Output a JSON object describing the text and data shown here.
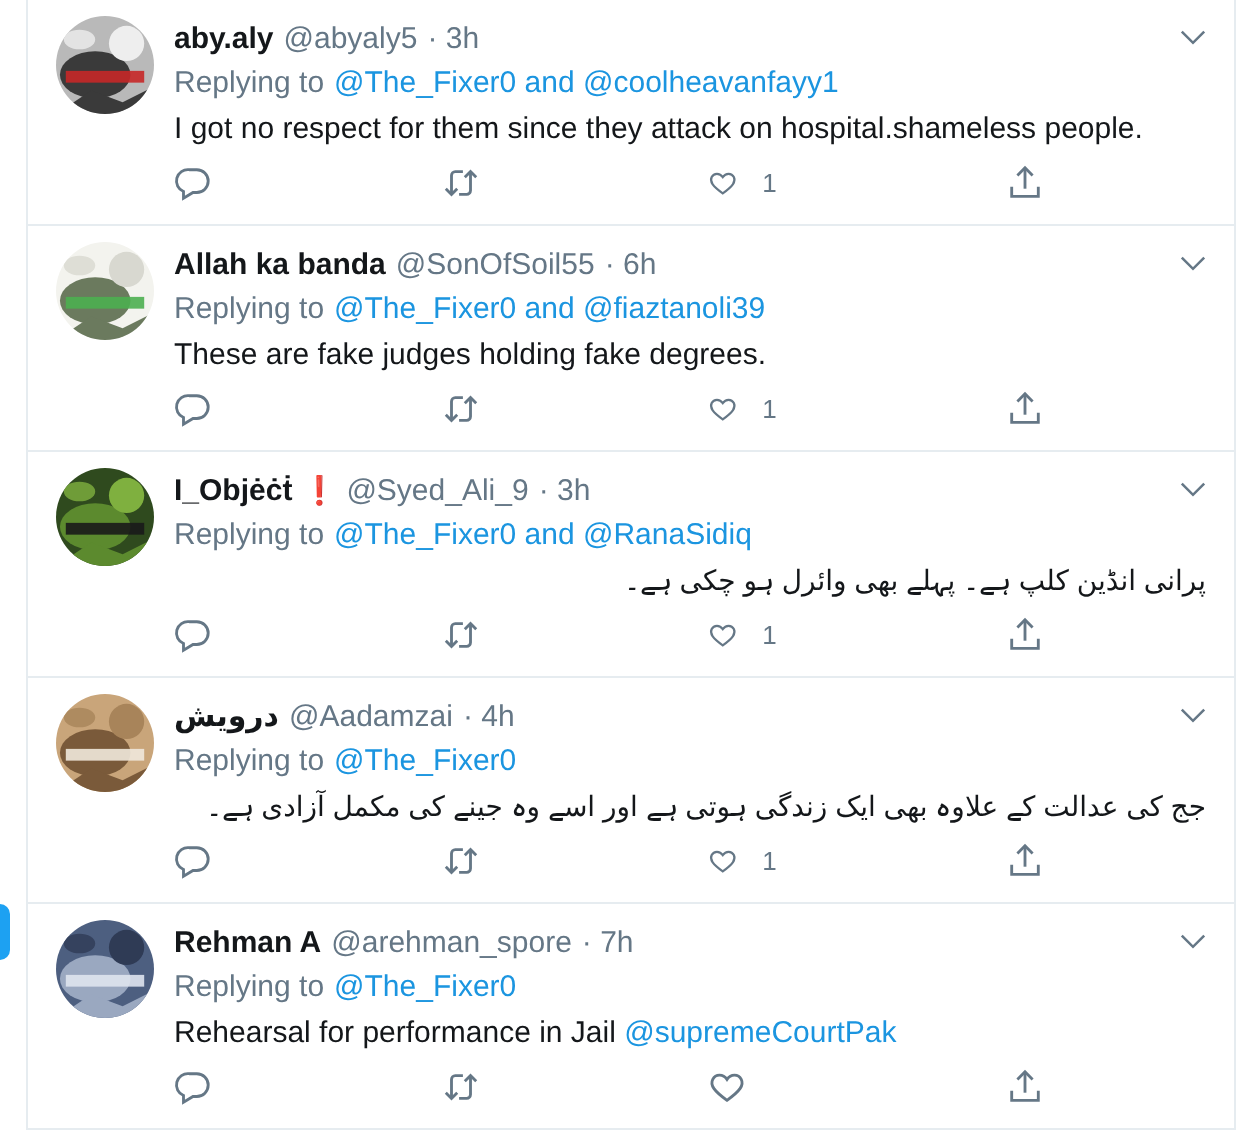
{
  "tweets": [
    {
      "name": "aby.aly",
      "handle": "@abyaly5",
      "time": "· 3h",
      "reply_prefix": "Replying to",
      "reply_to": "@The_Fixer0 and @coolheavanfayy1",
      "rtl": false,
      "body": [
        {
          "kind": "text",
          "text": "I got no respect for them since they attack on hospital.shameless people."
        }
      ],
      "likes": "1"
    },
    {
      "name": "Allah ka banda",
      "handle": "@SonOfSoil55",
      "time": "· 6h",
      "reply_prefix": "Replying to",
      "reply_to": "@The_Fixer0 and @fiaztanoli39",
      "rtl": false,
      "body": [
        {
          "kind": "text",
          "text": "These are fake judges holding fake degrees."
        }
      ],
      "likes": "1"
    },
    {
      "name": "I_Objėċṫ",
      "badge": "❗",
      "handle": "@Syed_Ali_9",
      "time": "· 3h",
      "reply_prefix": "Replying to",
      "reply_to": "@The_Fixer0 and @RanaSidiq",
      "rtl": true,
      "body": [
        {
          "kind": "text",
          "text": "پرانی انڈین کلپ ہے۔ پہلے بھی وائرل ہو چکی ہے۔"
        }
      ],
      "likes": "1"
    },
    {
      "name": "درویش",
      "handle": "@Aadamzai",
      "time": "· 4h",
      "reply_prefix": "Replying to",
      "reply_to": "@The_Fixer0",
      "rtl": true,
      "body": [
        {
          "kind": "text",
          "text": "جج کی عدالت کے علاوہ بھی ایک زندگی ہوتی ہے اور اسے وہ جینے کی مکمل آزادی ہے۔"
        }
      ],
      "likes": "1"
    },
    {
      "name": "Rehman A",
      "handle": "@arehman_spore",
      "time": "· 7h",
      "reply_prefix": "Replying to",
      "reply_to": "@The_Fixer0",
      "rtl": false,
      "body": [
        {
          "kind": "text",
          "text": "Rehearsal for performance in Jail "
        },
        {
          "kind": "mention",
          "text": "@supremeCourtPak"
        }
      ]
    }
  ]
}
